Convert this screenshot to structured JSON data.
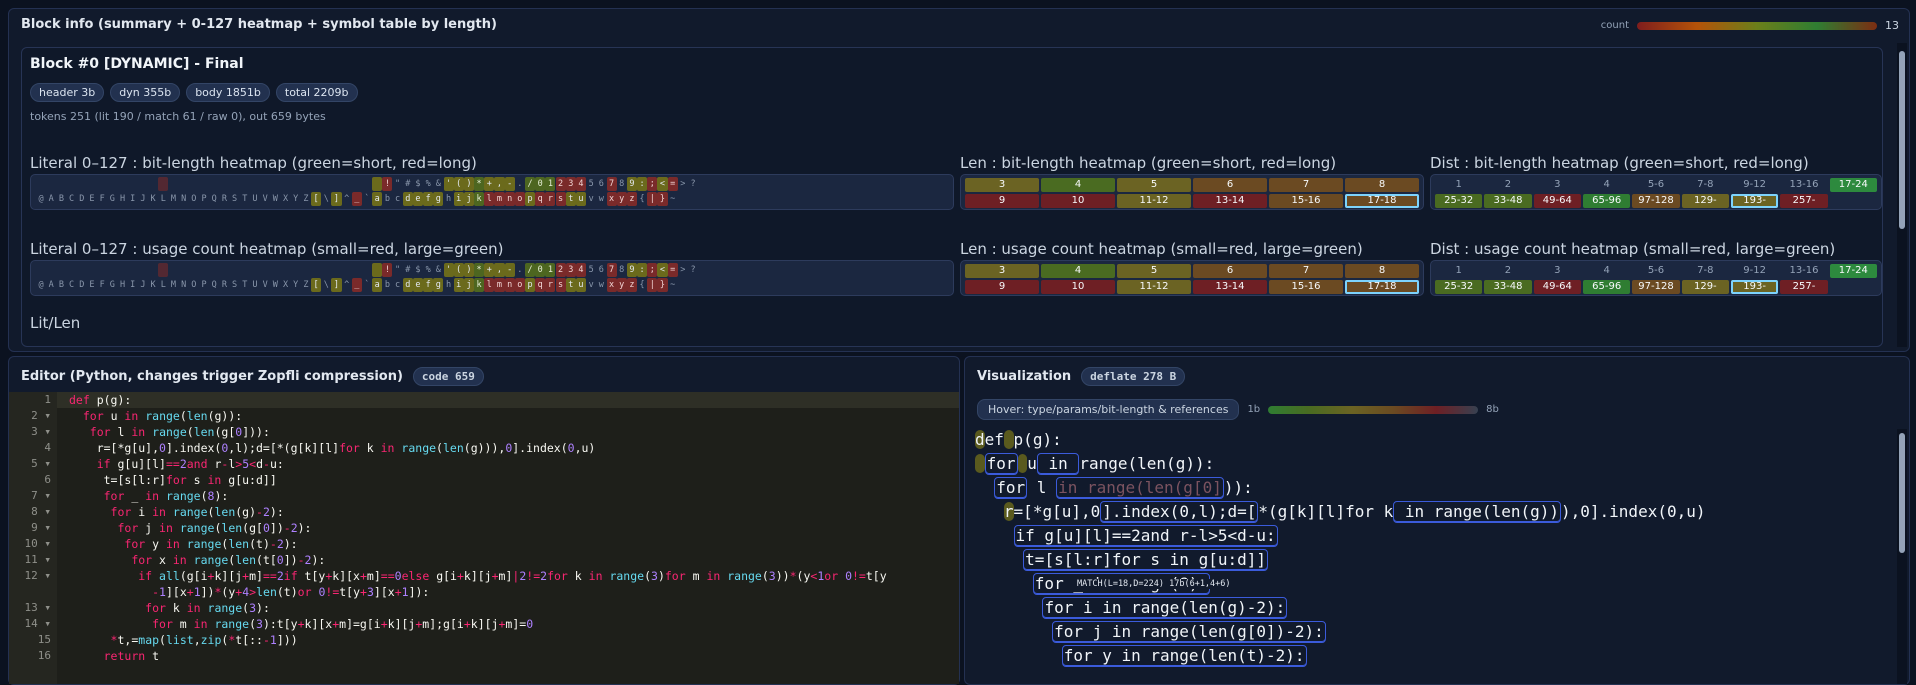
{
  "top": {
    "title": "Block info (summary + 0-127 heatmap + symbol table by length)",
    "count_label": "count",
    "count_value": "13"
  },
  "block": {
    "title": "Block #0 [DYNAMIC] - Final",
    "pills": [
      "header 3b",
      "dyn 355b",
      "body 1851b",
      "total 2209b"
    ],
    "tokens": "tokens 251 (lit 190 / match 61 / raw 0), out 659 bytes"
  },
  "sections": {
    "lit_bits": "Literal 0–127 : bit-length heatmap (green=short, red=long)",
    "len_bits": "Len : bit-length heatmap (green=short, red=long)",
    "dist_bits": "Dist : bit-length heatmap (green=short, red=long)",
    "lit_count": "Literal 0–127 : usage count heatmap (small=red, large=green)",
    "len_count": "Len : usage count heatmap (small=red, large=green)",
    "dist_count": "Dist : usage count heatmap (small=red, large=green)",
    "litlen": "Lit/Len"
  },
  "glyph_rows": {
    "row1": [
      " ",
      " ",
      " ",
      " ",
      " ",
      " ",
      " ",
      " ",
      " ",
      " ",
      " ",
      " ",
      " ",
      " ",
      " ",
      " ",
      " ",
      " ",
      " ",
      " ",
      " ",
      " ",
      " ",
      " ",
      " ",
      " ",
      " ",
      " ",
      " ",
      " ",
      " ",
      " ",
      " ",
      " ",
      "!",
      "\"",
      "#",
      "$",
      "%",
      "&",
      "'",
      "(",
      ")",
      "*",
      "+",
      ",",
      "-",
      ".",
      "/",
      "0",
      "1",
      "2",
      "3",
      "4",
      "5",
      "6",
      "7",
      "8",
      "9",
      ":",
      ";",
      "<",
      "=",
      ">",
      "?"
    ],
    "row2": [
      "@",
      "A",
      "B",
      "C",
      "D",
      "E",
      "F",
      "G",
      "H",
      "I",
      "J",
      "K",
      "L",
      "M",
      "N",
      "O",
      "P",
      "Q",
      "R",
      "S",
      "T",
      "U",
      "V",
      "W",
      "X",
      "Y",
      "Z",
      "[",
      "\\",
      "]",
      "^",
      "_",
      "`",
      "a",
      "b",
      "c",
      "d",
      "e",
      "f",
      "g",
      "h",
      "i",
      "j",
      "k",
      "l",
      "m",
      "n",
      "o",
      "p",
      "q",
      "r",
      "s",
      "t",
      "u",
      "v",
      "w",
      "x",
      "y",
      "z",
      "{",
      "|",
      "}",
      "~",
      " "
    ]
  },
  "len_table": {
    "row1": [
      "3",
      "4",
      "5",
      "6",
      "7",
      "8"
    ],
    "row2": [
      "9",
      "10",
      "11-12",
      "13-14",
      "15-16",
      "17-18"
    ]
  },
  "dist_table": {
    "row1": [
      "1",
      "2",
      "3",
      "4",
      "5-6",
      "7-8",
      "9-12",
      "13-16",
      "17-24"
    ],
    "row2": [
      "25-32",
      "33-48",
      "49-64",
      "65-96",
      "97-128",
      "129-",
      "193-",
      "257-",
      ""
    ]
  },
  "editor": {
    "title": "Editor (Python, changes trigger Zopfli compression)",
    "tag": "code 659",
    "line_numbers": [
      "1",
      "2",
      "3",
      "4",
      "5",
      "6",
      "7",
      "8",
      "9",
      "10",
      "11",
      "12",
      "",
      "13",
      "14",
      "15",
      "16"
    ]
  },
  "viz": {
    "title": "Visualization",
    "tag": "deflate 278 B",
    "hover_label": "Hover: type/params/bit-length & references",
    "bar_min": "1b",
    "bar_max": "8b",
    "tooltip": "MATCH(L=18,D=224) 17b(6+1,4+6)"
  },
  "colors": {
    "accent": "#7dd3fc",
    "panel": "#111a2c",
    "bg": "#0b1220"
  }
}
